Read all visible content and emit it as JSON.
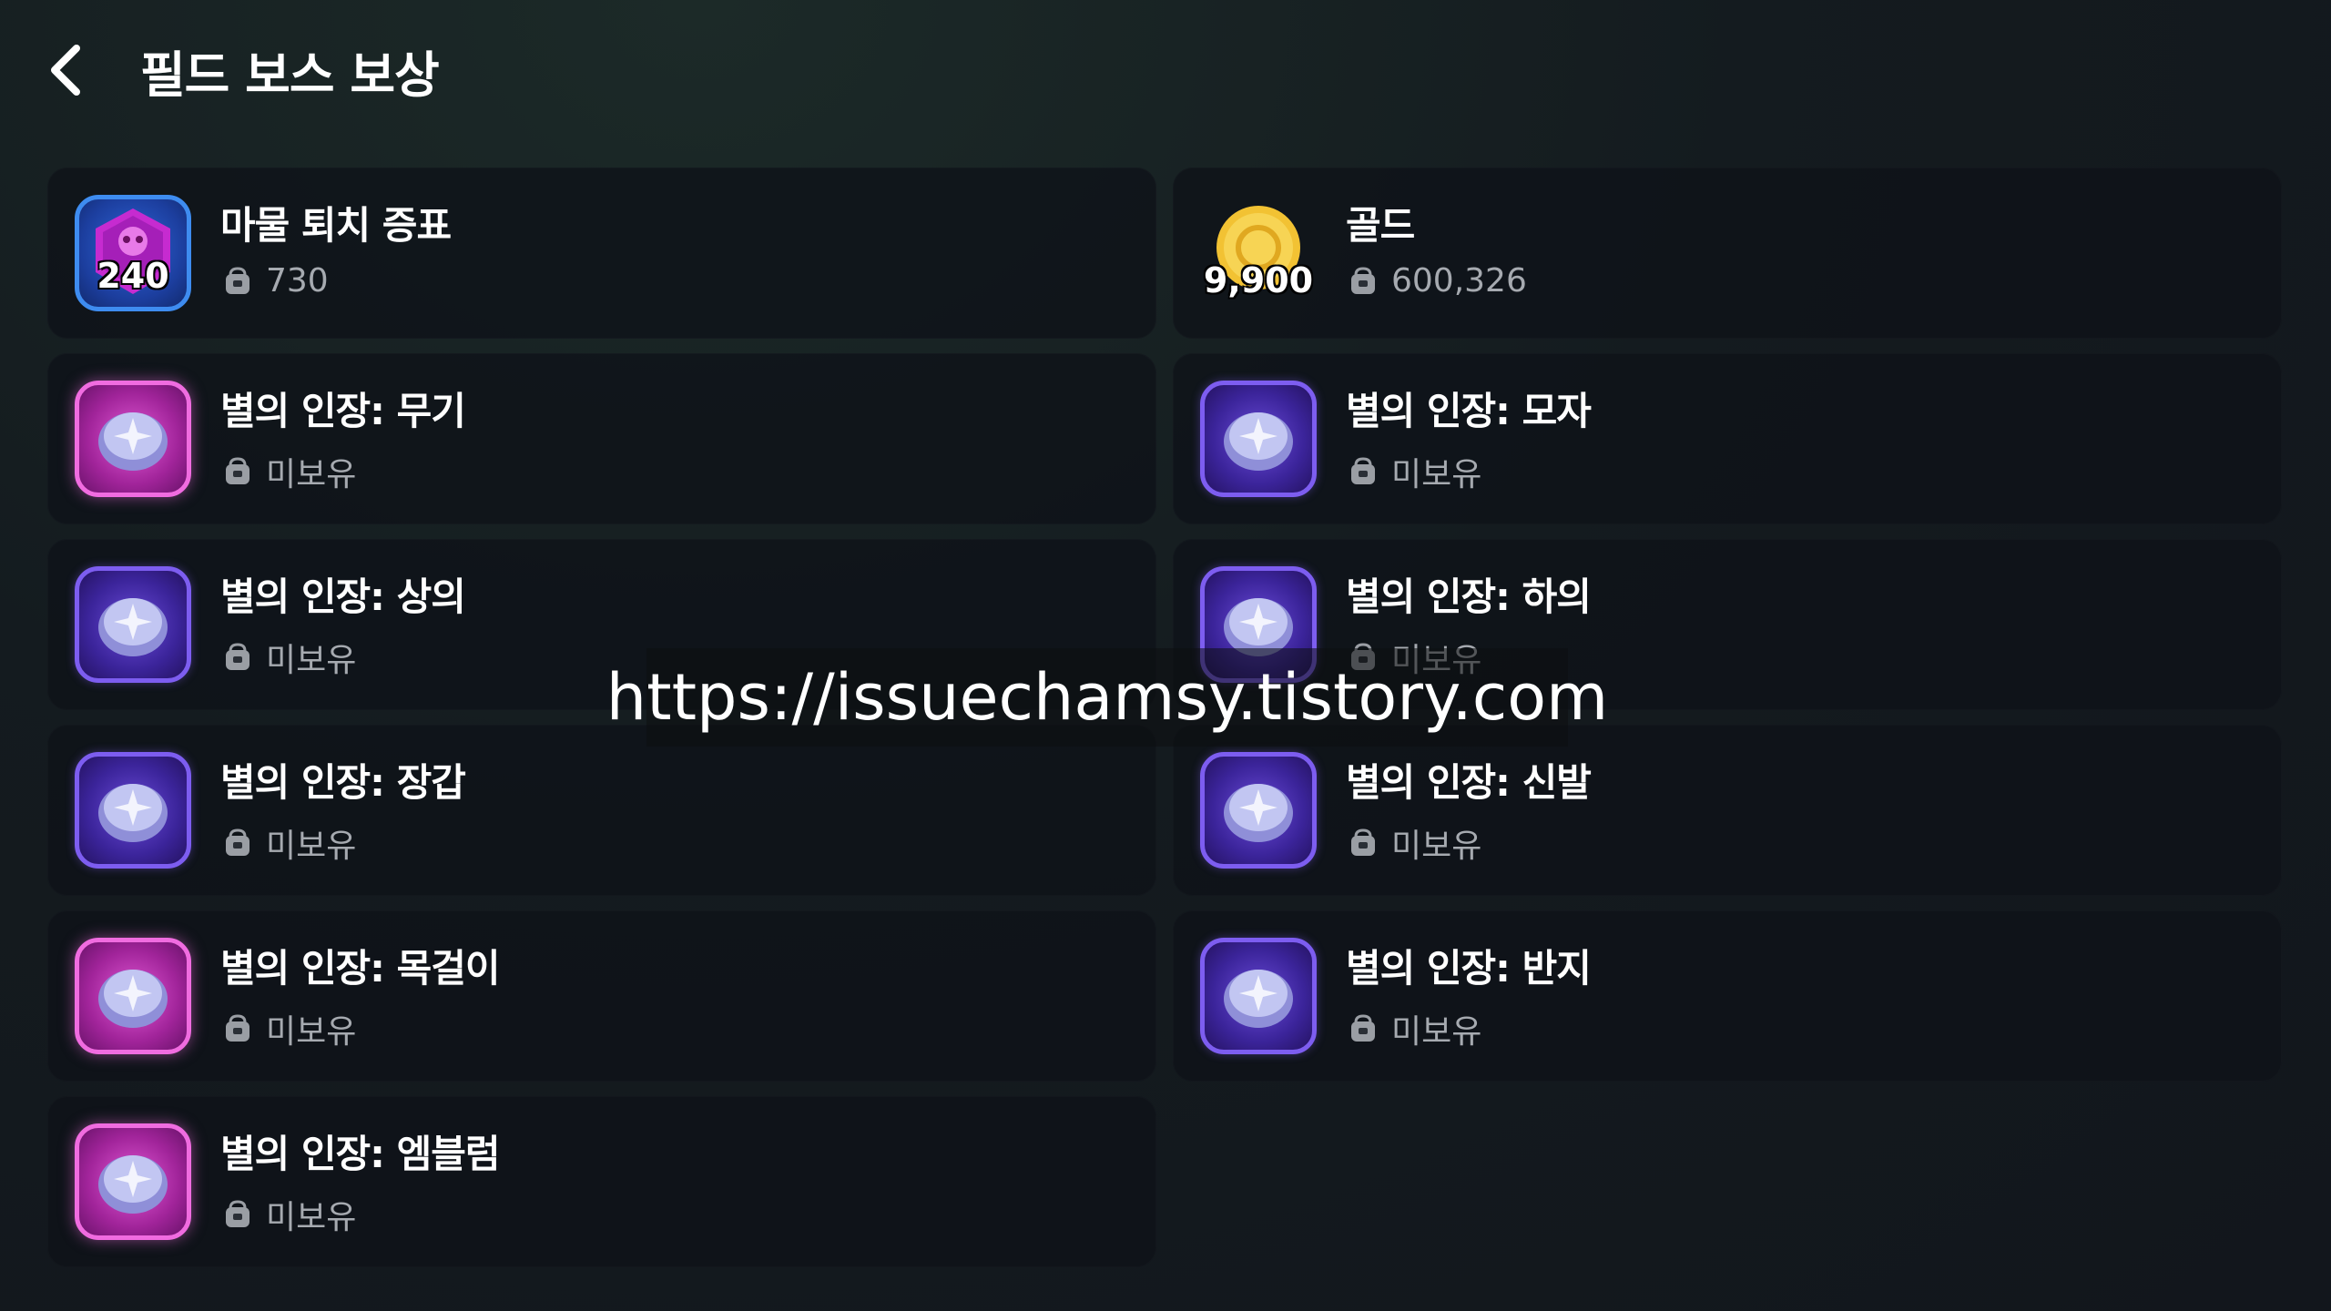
{
  "header": {
    "title": "필드 보스 보상",
    "back_icon": "chevron-left-icon"
  },
  "rewards": [
    {
      "name": "마물 퇴치 증표",
      "quantity": "240",
      "owned": "730",
      "icon": "monster-token-icon",
      "frame": "blue"
    },
    {
      "name": "골드",
      "quantity": "9,900",
      "owned": "600,326",
      "icon": "gold-coin-icon",
      "frame": "gold"
    },
    {
      "name": "별의 인장: 무기",
      "owned": "미보유",
      "icon": "star-seal-icon",
      "frame": "pink"
    },
    {
      "name": "별의 인장: 모자",
      "owned": "미보유",
      "icon": "star-seal-icon",
      "frame": "purple"
    },
    {
      "name": "별의 인장: 상의",
      "owned": "미보유",
      "icon": "star-seal-icon",
      "frame": "purple"
    },
    {
      "name": "별의 인장: 하의",
      "owned": "미보유",
      "icon": "star-seal-icon",
      "frame": "purple"
    },
    {
      "name": "별의 인장: 장갑",
      "owned": "미보유",
      "icon": "star-seal-icon",
      "frame": "purple"
    },
    {
      "name": "별의 인장: 신발",
      "owned": "미보유",
      "icon": "star-seal-icon",
      "frame": "purple"
    },
    {
      "name": "별의 인장: 목걸이",
      "owned": "미보유",
      "icon": "star-seal-icon",
      "frame": "pink"
    },
    {
      "name": "별의 인장: 반지",
      "owned": "미보유",
      "icon": "star-seal-icon",
      "frame": "purple"
    },
    {
      "name": "별의 인장: 엠블럼",
      "owned": "미보유",
      "icon": "star-seal-icon",
      "frame": "pink"
    }
  ],
  "owned_icon": "inventory-bag-icon",
  "watermark": "https://issuechamsy.tistory.com",
  "colors": {
    "purple_frame": "#7d5df0",
    "pink_frame": "#f06ce0",
    "blue_frame": "#3e8cf0",
    "gold": "#f2c233"
  }
}
